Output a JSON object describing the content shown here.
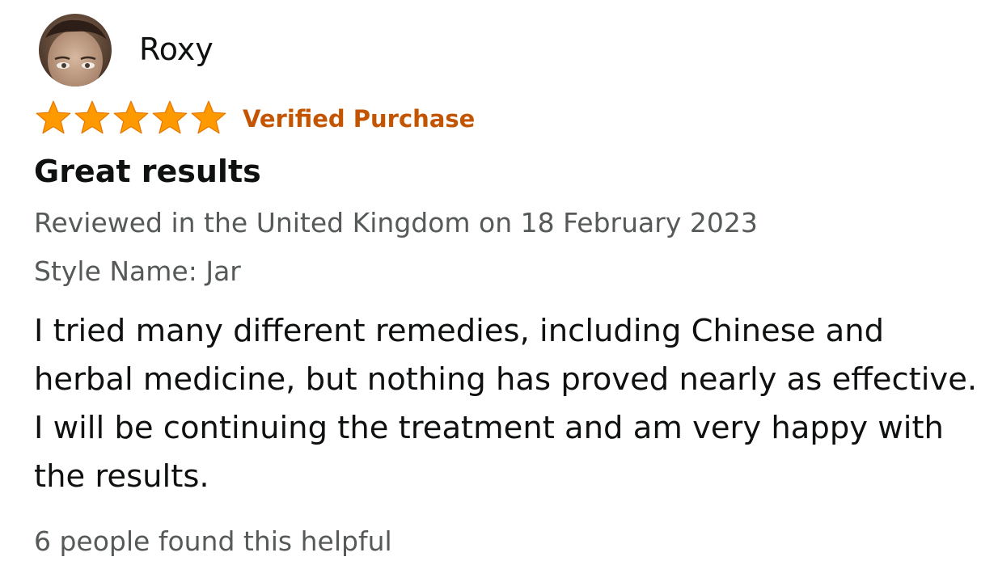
{
  "review": {
    "reviewer_name": "Roxy",
    "avatar_icon": "user-avatar-photo",
    "rating": 5,
    "rating_max": 5,
    "star_color": "#ff9900",
    "verified_label": "Verified Purchase",
    "verified_color": "#c45500",
    "title": "Great results",
    "date_line": "Reviewed in the United Kingdom on 18 February 2023",
    "style_line": "Style Name: Jar",
    "body": "I tried many different remedies, including Chinese and herbal medicine, but nothing has proved nearly as effective. I will be continuing the treatment and am very happy with the results.",
    "helpful_text": "6 people found this helpful"
  }
}
